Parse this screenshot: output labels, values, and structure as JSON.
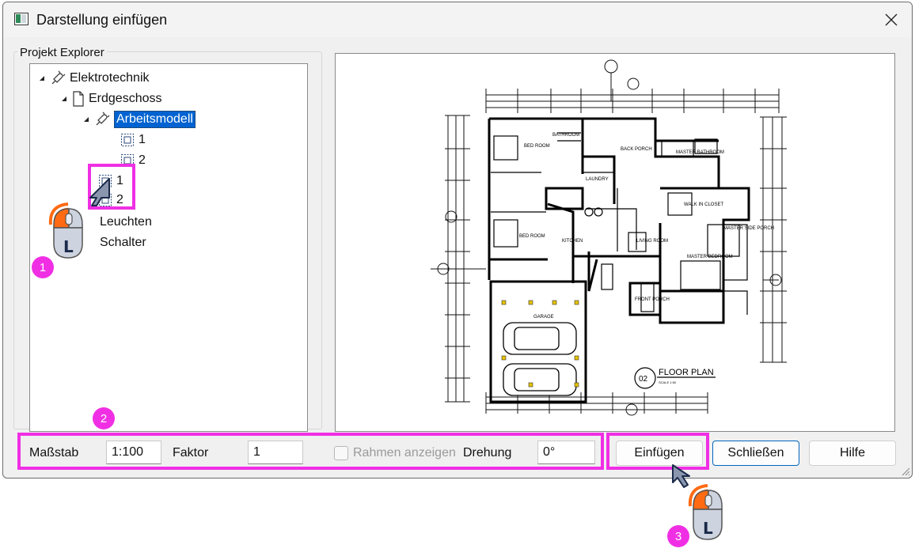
{
  "window": {
    "title": "Darstellung einfügen"
  },
  "explorer": {
    "group_label": "Projekt Explorer",
    "tree": [
      {
        "label": "Elektrotechnik",
        "icon": "plug-icon"
      },
      {
        "label": "Erdgeschoss",
        "icon": "document-icon"
      },
      {
        "label": "Arbeitsmodell",
        "icon": "plug-icon",
        "selected": true
      },
      {
        "label": "1",
        "icon": "view-icon"
      },
      {
        "label": "2",
        "icon": "view-icon"
      },
      {
        "label": "1",
        "icon": "view-icon"
      },
      {
        "label": "2",
        "icon": "view-icon"
      },
      {
        "label": "Leuchten"
      },
      {
        "label": "Schalter"
      }
    ]
  },
  "preview": {
    "title": "FLOOR PLAN",
    "number": "02",
    "scale_note": "SCALE 1:50",
    "rooms": [
      "BED ROOM",
      "BATHROOM",
      "BACK PORCH",
      "MASTER BATHROOM",
      "LAUNDRY",
      "WALK IN CLOSET",
      "BED ROOM",
      "KITCHEN",
      "LIVING ROOM",
      "MASTER SIDE PORCH",
      "MASTER BEDROOM",
      "FRONT PORCH",
      "GARAGE"
    ]
  },
  "form": {
    "scale_label": "Maßstab",
    "scale_value": "1:100",
    "factor_label": "Faktor",
    "factor_value": "1",
    "frame_label": "Rahmen anzeigen",
    "frame_checked": false,
    "rotation_label": "Drehung",
    "rotation_value": "0°"
  },
  "buttons": {
    "insert": "Einfügen",
    "close": "Schließen",
    "help": "Hilfe"
  },
  "annotations": {
    "step1": "1",
    "step2": "2",
    "step3": "3",
    "mouse_label": "L"
  },
  "colors": {
    "highlight": "#f02fe4",
    "selection": "#0063d1",
    "accent": "#0067c0"
  }
}
